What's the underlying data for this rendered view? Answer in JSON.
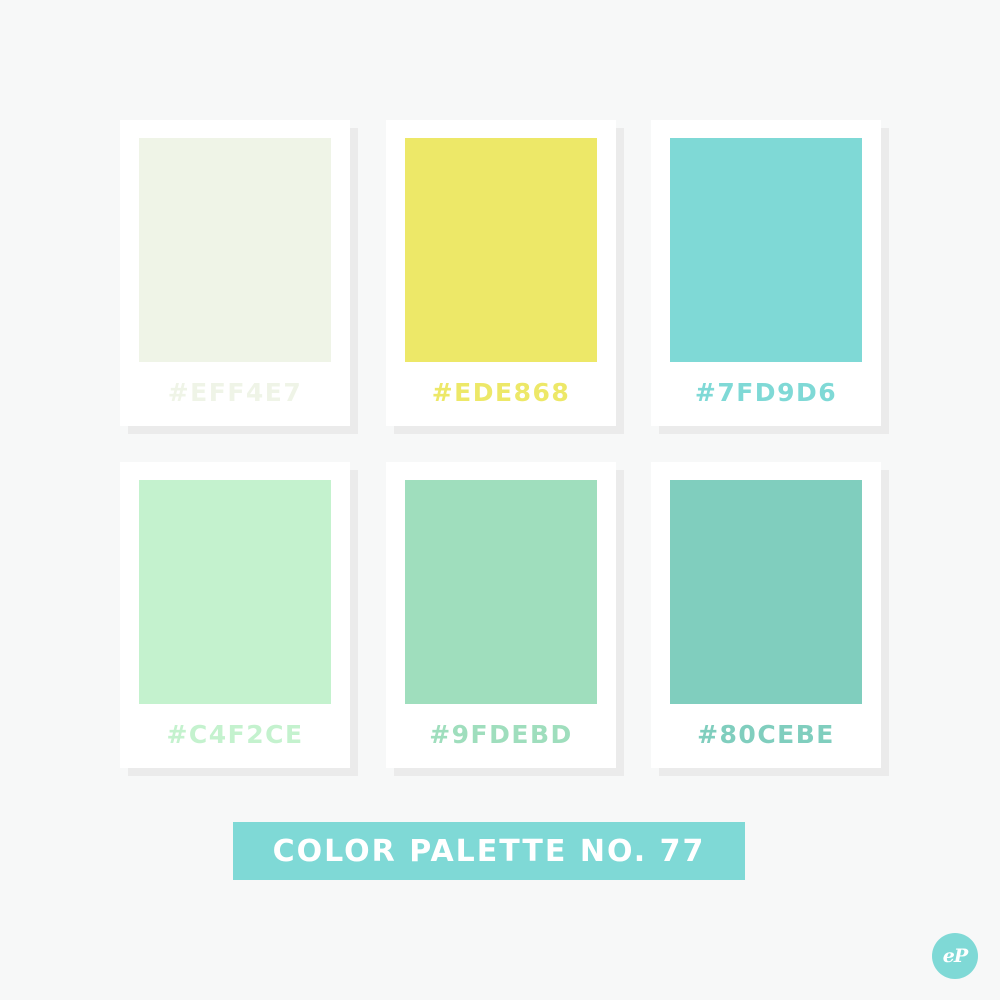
{
  "palette": {
    "swatches": [
      {
        "hex_label": "#EFF4E7",
        "color": "#eff4e7"
      },
      {
        "hex_label": "#EDE868",
        "color": "#ede868"
      },
      {
        "hex_label": "#7FD9D6",
        "color": "#7fd9d6"
      },
      {
        "hex_label": "#C4F2CE",
        "color": "#c4f2ce"
      },
      {
        "hex_label": "#9FDEBD",
        "color": "#9fdebd"
      },
      {
        "hex_label": "#80CEBE",
        "color": "#80cebe"
      }
    ]
  },
  "title": "COLOR PALETTE NO. 77",
  "accent_color": "#7fd9d6",
  "logo": {
    "text": "eP",
    "icon": "ep-logo-icon"
  }
}
